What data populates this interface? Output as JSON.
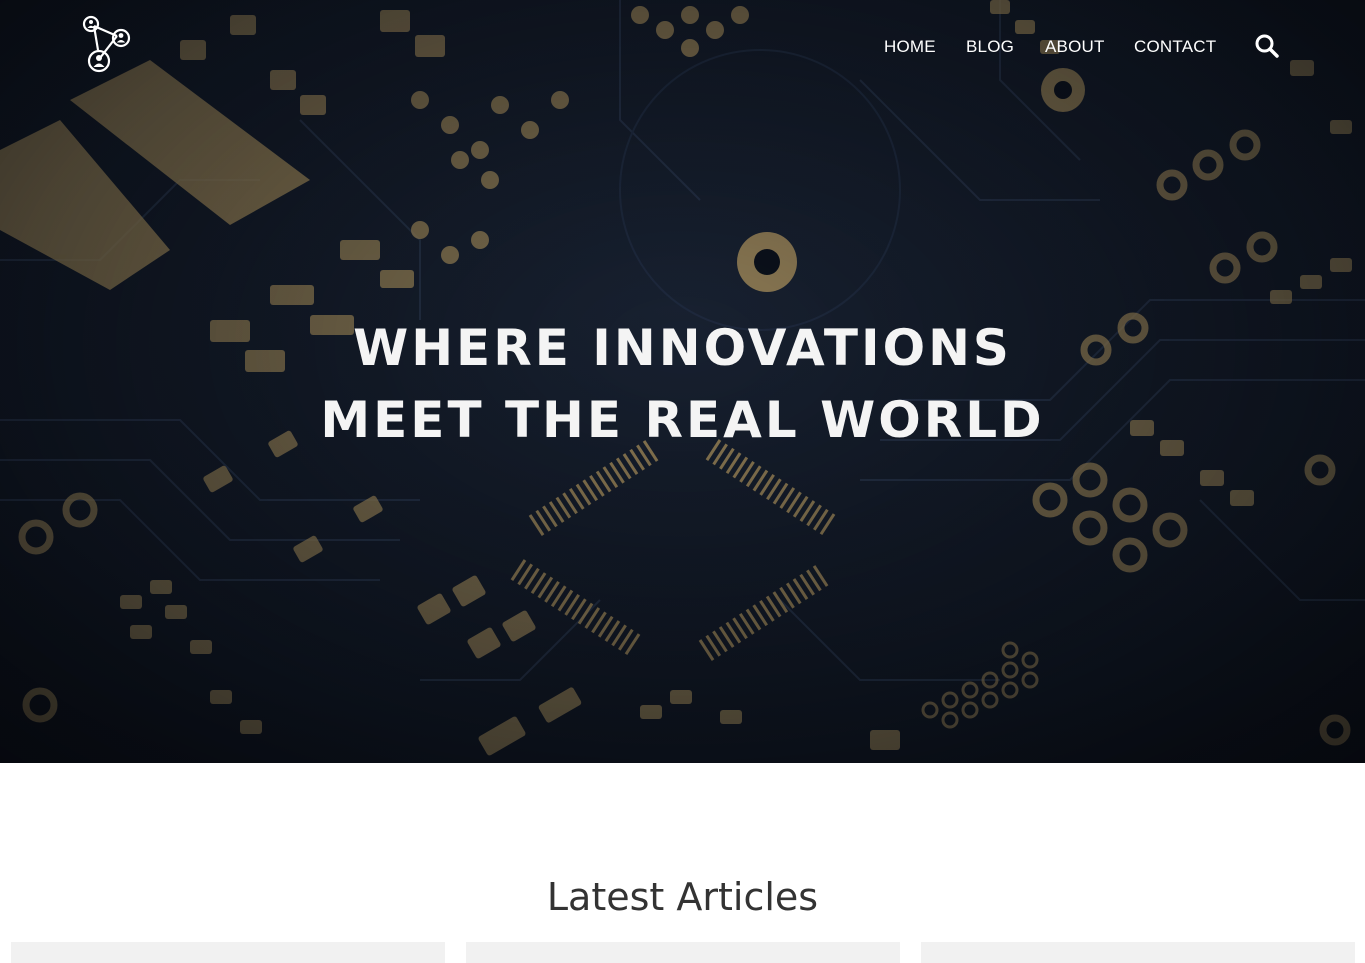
{
  "nav": {
    "items": [
      "HOME",
      "BLOG",
      "ABOUT",
      "CONTACT"
    ]
  },
  "hero": {
    "line1": "WHERE INNOVATIONS",
    "line2": "MEET THE REAL WORLD"
  },
  "articles": {
    "title": "Latest Articles",
    "card_count": 3
  },
  "icons": {
    "logo": "network-nodes-icon",
    "search": "search-icon"
  },
  "colors": {
    "hero_dark": "#0e1622",
    "pcb_gold": "#c8a96a",
    "text_light": "#ffffff",
    "title_dark": "#333333",
    "card_bg": "#f1f1f1"
  }
}
